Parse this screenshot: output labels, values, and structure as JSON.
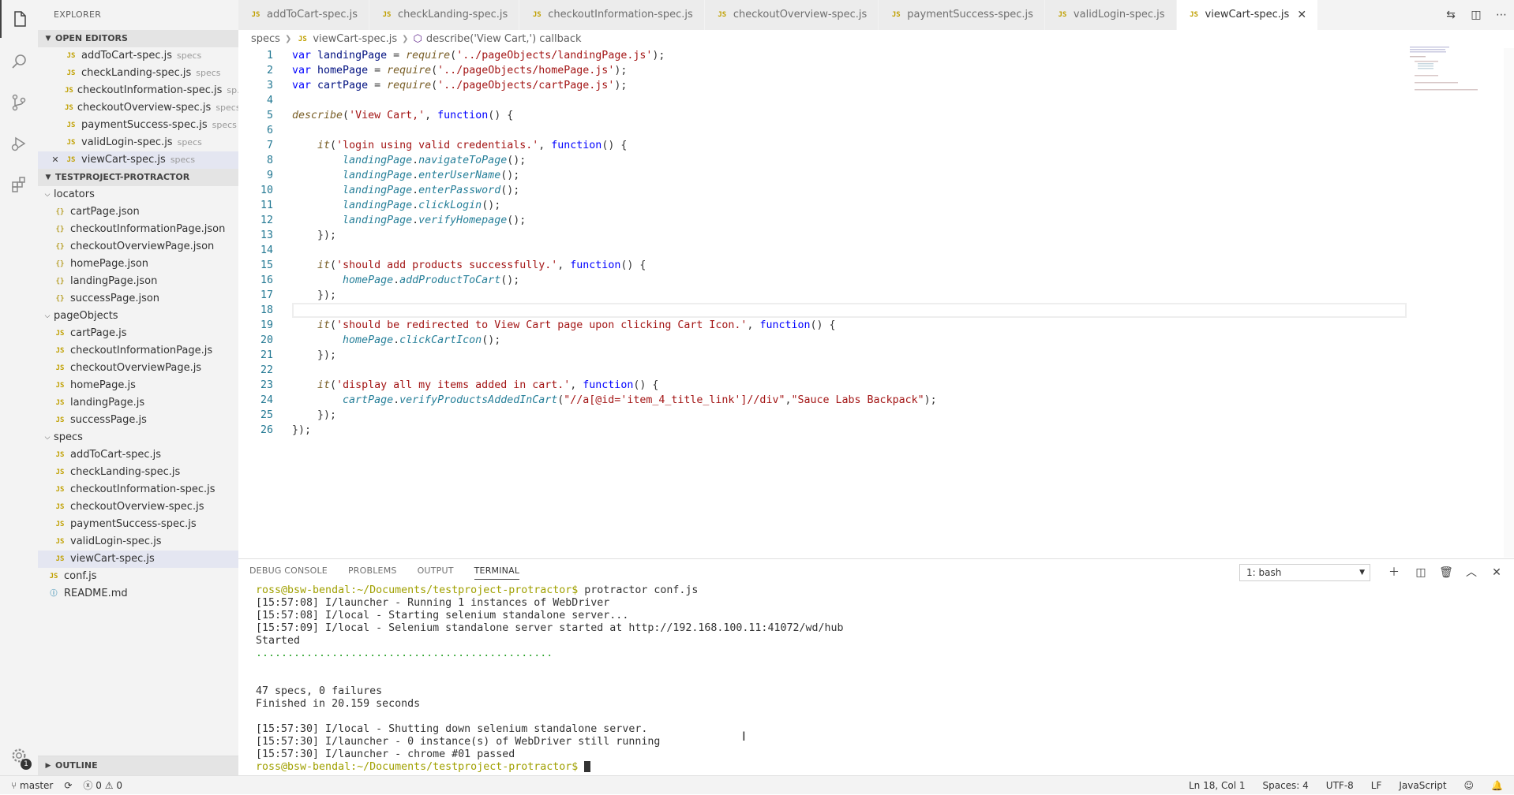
{
  "sidebar": {
    "title": "EXPLORER",
    "open_editors": {
      "label": "OPEN EDITORS",
      "items": [
        {
          "name": "addToCart-spec.js",
          "desc": "specs"
        },
        {
          "name": "checkLanding-spec.js",
          "desc": "specs"
        },
        {
          "name": "checkoutInformation-spec.js",
          "desc": "sp..."
        },
        {
          "name": "checkoutOverview-spec.js",
          "desc": "specs"
        },
        {
          "name": "paymentSuccess-spec.js",
          "desc": "specs"
        },
        {
          "name": "validLogin-spec.js",
          "desc": "specs"
        },
        {
          "name": "viewCart-spec.js",
          "desc": "specs"
        }
      ]
    },
    "project": {
      "label": "TESTPROJECT-PROTRACTOR",
      "locators": {
        "label": "locators",
        "files": [
          "cartPage.json",
          "checkoutInformationPage.json",
          "checkoutOverviewPage.json",
          "homePage.json",
          "landingPage.json",
          "successPage.json"
        ]
      },
      "pageObjects": {
        "label": "pageObjects",
        "files": [
          "cartPage.js",
          "checkoutInformationPage.js",
          "checkoutOverviewPage.js",
          "homePage.js",
          "landingPage.js",
          "successPage.js"
        ]
      },
      "specs": {
        "label": "specs",
        "files": [
          "addToCart-spec.js",
          "checkLanding-spec.js",
          "checkoutInformation-spec.js",
          "checkoutOverview-spec.js",
          "paymentSuccess-spec.js",
          "validLogin-spec.js",
          "viewCart-spec.js"
        ]
      },
      "root_files": [
        "conf.js",
        "README.md"
      ]
    },
    "outline_label": "OUTLINE"
  },
  "tabs": [
    {
      "label": "addToCart-spec.js"
    },
    {
      "label": "checkLanding-spec.js"
    },
    {
      "label": "checkoutInformation-spec.js"
    },
    {
      "label": "checkoutOverview-spec.js"
    },
    {
      "label": "paymentSuccess-spec.js"
    },
    {
      "label": "validLogin-spec.js"
    },
    {
      "label": "viewCart-spec.js"
    }
  ],
  "breadcrumb": {
    "folder": "specs",
    "file": "viewCart-spec.js",
    "symbol": "describe('View Cart,') callback"
  },
  "code": {
    "line_numbers": [
      "1",
      "2",
      "3",
      "4",
      "5",
      "6",
      "7",
      "8",
      "9",
      "10",
      "11",
      "12",
      "13",
      "14",
      "15",
      "16",
      "17",
      "18",
      "19",
      "20",
      "21",
      "22",
      "23",
      "24",
      "25",
      "26"
    ],
    "l1": {
      "a": "var ",
      "b": "landingPage",
      "c": " = ",
      "d": "require",
      "e": "(",
      "f": "'../pageObjects/landingPage.js'",
      "g": ");"
    },
    "l2": {
      "a": "var ",
      "b": "homePage",
      "c": " = ",
      "d": "require",
      "e": "(",
      "f": "'../pageObjects/homePage.js'",
      "g": ");"
    },
    "l3": {
      "a": "var ",
      "b": "cartPage",
      "c": " = ",
      "d": "require",
      "e": "(",
      "f": "'../pageObjects/cartPage.js'",
      "g": ");"
    },
    "l5": {
      "a": "describe",
      "b": "(",
      "c": "'View Cart,'",
      "d": ", ",
      "e": "function",
      "f": "() {"
    },
    "l7": {
      "a": "    it",
      "b": "(",
      "c": "'login using valid credentials.'",
      "d": ", ",
      "e": "function",
      "f": "() {"
    },
    "l8": {
      "a": "        landingPage",
      "b": ".",
      "c": "navigateToPage",
      "d": "();"
    },
    "l9": {
      "a": "        landingPage",
      "b": ".",
      "c": "enterUserName",
      "d": "();"
    },
    "l10": {
      "a": "        landingPage",
      "b": ".",
      "c": "enterPassword",
      "d": "();"
    },
    "l11": {
      "a": "        landingPage",
      "b": ".",
      "c": "clickLogin",
      "d": "();"
    },
    "l12": {
      "a": "        landingPage",
      "b": ".",
      "c": "verifyHomepage",
      "d": "();"
    },
    "close_inner": "    });",
    "l15": {
      "a": "    it",
      "b": "(",
      "c": "'should add products successfully.'",
      "d": ", ",
      "e": "function",
      "f": "() {"
    },
    "l16": {
      "a": "        homePage",
      "b": ".",
      "c": "addProductToCart",
      "d": "();"
    },
    "l19": {
      "a": "    it",
      "b": "(",
      "c": "'should be redirected to View Cart page upon clicking Cart Icon.'",
      "d": ", ",
      "e": "function",
      "f": "() {"
    },
    "l20": {
      "a": "        homePage",
      "b": ".",
      "c": "clickCartIcon",
      "d": "();"
    },
    "l23": {
      "a": "    it",
      "b": "(",
      "c": "'display all my items added in cart.'",
      "d": ", ",
      "e": "function",
      "f": "() {"
    },
    "l24": {
      "a": "        cartPage",
      "b": ".",
      "c": "verifyProductsAddedInCart",
      "d": "(",
      "e": "\"//a[@id='item_4_title_link']//div\"",
      "f": ",",
      "g": "\"Sauce Labs Backpack\"",
      "h": ");"
    },
    "l26": "});"
  },
  "panel": {
    "tabs": [
      "DEBUG CONSOLE",
      "PROBLEMS",
      "OUTPUT",
      "TERMINAL"
    ],
    "terminal_select": "1: bash",
    "prompt": "ross@bsw-bendal:~/Documents/testproject-protractor$",
    "command": " protractor conf.js",
    "lines": [
      "[15:57:08] I/launcher - Running 1 instances of WebDriver",
      "[15:57:08] I/local - Starting selenium standalone server...",
      "[15:57:09] I/local - Selenium standalone server started at http://192.168.100.11:41072/wd/hub",
      "Started"
    ],
    "dots": "...............................................",
    "summary": [
      "47 specs, 0 failures",
      "Finished in 20.159 seconds"
    ],
    "end_lines": [
      "[15:57:30] I/local - Shutting down selenium standalone server.",
      "[15:57:30] I/launcher - 0 instance(s) of WebDriver still running",
      "[15:57:30] I/launcher - chrome #01 passed"
    ]
  },
  "status": {
    "branch": "master",
    "errors": "0",
    "warnings": "0",
    "position": "Ln 18, Col 1",
    "spaces": "Spaces: 4",
    "encoding": "UTF-8",
    "eol": "LF",
    "language": "JavaScript",
    "settings_badge": "1"
  }
}
